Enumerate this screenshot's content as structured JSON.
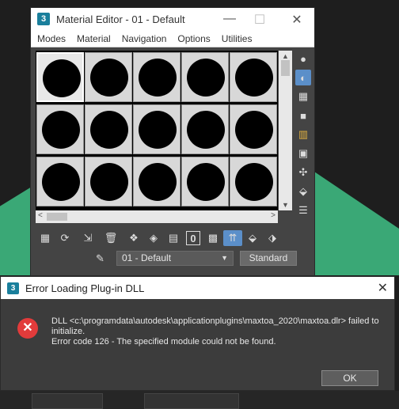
{
  "material_editor": {
    "app_icon": "3",
    "title": "Material Editor - 01 - Default",
    "window_controls": [
      "—",
      "☐",
      "✕"
    ],
    "menu": [
      "Modes",
      "Material",
      "Navigation",
      "Options",
      "Utilities"
    ],
    "slots": {
      "rows": 3,
      "cols": 5,
      "selected": 0
    },
    "side_tools": [
      "sample-type-icon",
      "backlight-icon",
      "background-icon",
      "sample-uv-tiling-icon",
      "video-color-check-icon",
      "make-preview-icon",
      "material-options-icon",
      "select-by-material-icon",
      "material-map-navigator-icon"
    ],
    "bottom_tools": [
      "get-material-icon",
      "put-to-scene-icon",
      "assign-to-selection-icon",
      "reset-map-icon",
      "copy-material-icon",
      "make-unique-icon",
      "put-to-library-icon",
      "material-id-channel-icon",
      "show-shaded-icon",
      "show-end-result-icon",
      "go-to-parent-icon",
      "go-forward-sibling-icon"
    ],
    "material_id_label": "0",
    "material_name": "01 - Default",
    "material_type": "Standard"
  },
  "dialog": {
    "app_icon": "3",
    "title": "Error Loading Plug-in DLL",
    "close": "✕",
    "error_icon": "✕",
    "message_line1": "DLL <c:\\programdata\\autodesk\\applicationplugins\\maxtoa_2020\\maxtoa.dlr> failed to",
    "message_line2": "initialize.",
    "message_line3": "Error code 126 - The specified module could not be found.",
    "ok_label": "OK"
  },
  "colors": {
    "accent": "#5b8fc9",
    "error": "#e23b3b",
    "background_green": "#3aa876"
  }
}
